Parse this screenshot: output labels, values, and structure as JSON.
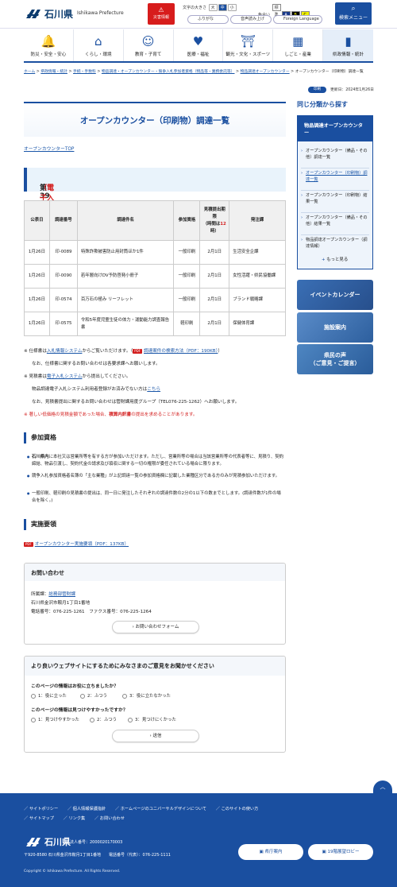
{
  "header": {
    "logo_ja": "石川県",
    "logo_en": "Ishikawa Prefecture",
    "disaster_label": "災害情報",
    "font_size_label": "文字の大きさ",
    "font_sizes": [
      "大",
      "中",
      "小"
    ],
    "color_label": "色合い",
    "colors": [
      "標準",
      "A",
      "B",
      "C"
    ],
    "furigana": "ふりがな",
    "read_aloud": "音声読み上げ",
    "foreign": "Foreign Language",
    "search_label": "検索メニュー"
  },
  "nav": [
    {
      "label": "防災・安全・安心",
      "icon": "alarm-icon"
    },
    {
      "label": "くらし・環境",
      "icon": "house-icon"
    },
    {
      "label": "教育・子育て",
      "icon": "child-icon"
    },
    {
      "label": "医療・福祉",
      "icon": "heart-hand-icon"
    },
    {
      "label": "観光・文化・スポーツ",
      "icon": "temple-icon"
    },
    {
      "label": "しごと・産業",
      "icon": "factory-icon"
    },
    {
      "label": "県政情報・統計",
      "icon": "graph-icon"
    }
  ],
  "breadcrumb": [
    "ホーム",
    "県政情報・統計",
    "手続・手数料",
    "物品調達・オープンカウンター・競争入札参加者資格（物品等・業務委託等）",
    "物品調達オープンカウンター",
    "オープンカウンター（印刷物）調達一覧"
  ],
  "print_label": "印刷",
  "updated": "更新日：2024年1月26日",
  "page_title": "オープンカウンター（印刷物）調達一覧",
  "top_link": "オープンカウンターTOP",
  "round_heading": {
    "prefix": "第39回",
    "suffix": "（電子入札）"
  },
  "table": {
    "headers": [
      "公表日",
      "調達番号",
      "調達件名",
      "参加資格",
      "見積提出期限",
      "（時間は",
      "12",
      "時）",
      "発注課"
    ],
    "rows": [
      {
        "date": "1月26日",
        "no": "印-0089",
        "name": "特殊詐欺被害防止用封筒ほか1件",
        "qual": "一般印刷",
        "due": "2月1日",
        "dept": "生活安全企課"
      },
      {
        "date": "1月26日",
        "no": "印-0090",
        "name": "若年層向けDV予防啓発小冊子",
        "qual": "一般印刷",
        "due": "2月1日",
        "dept": "女性活躍・県民協働課"
      },
      {
        "date": "1月26日",
        "no": "印-0574",
        "name": "百万石の極み リーフレット",
        "qual": "一般印刷",
        "due": "2月1日",
        "dept": "ブランド戦略課"
      },
      {
        "date": "1月26日",
        "no": "印-0575",
        "name": "令和5年度児童生徒の体力・運動能力調査報告書",
        "qual": "軽印刷",
        "due": "2月1日",
        "dept": "保健体育課"
      }
    ]
  },
  "notes": {
    "n1a": "※ 仕様書は",
    "n1_link": "入札情報システム",
    "n1b": "からご覧いただけます。（",
    "n1_pdf": "調達案件の検索方法（PDF：190KB）",
    "n1c": "）",
    "n2": "なお、仕様書に関するお問い合わせは各要求課へお願いします。",
    "n3a": "※ 見積書は",
    "n3_link": "電子入札システム",
    "n3b": "から提出してください。",
    "n4a": "物品調達電子入札システム利用者登録がお済みでない方は",
    "n4_link": "こちら",
    "n5": "なお、見積書提出に関するお問い合わせは管財課用度グループ（TEL076-225-1262）へお願いします。",
    "n6a": "※ 著しい低価格の見積金額であった場合、",
    "n6b": "積算内訳書",
    "n6c": "の提出を求めることがあります。"
  },
  "section_qual": "参加資格",
  "qual_bullets": [
    {
      "bold": "石川県内",
      "text": "に本社又は営業所等を有する方が参加いただけます。ただし、営業所等の場合は当該営業所等の代表者等に、見積り、契約締結、物品引渡し、契約代金の請求及び領収に関する一切の権限が委任されている場合に限ります。"
    },
    {
      "bold": "",
      "text": "競争入札参加資格者名簿の「主な業種」が上記調達一覧の参加資格欄に記載した業種区分である方のみが見積参加いただけます。"
    },
    {
      "bold": "",
      "text": "一般印刷、軽印刷の見積書の提出は、同一日に発注したそれぞれの調達件数の2分の1以下の数までとします。(調達件数が1件の場合を除く。)"
    }
  ],
  "section_impl": "実施要領",
  "impl_link": "オープンカウンター実施要領（PDF：137KB）",
  "contact": {
    "title": "お問い合わせ",
    "dept_label": "所属課：",
    "dept": "総務部管財課",
    "addr": "石川県金沢市鞍月1丁目1番地",
    "tel": "電話番号：076-225-1261　ファクス番号：076-225-1264",
    "form_btn": "お問い合わせフォーム"
  },
  "survey": {
    "title": "より良いウェブサイトにするためにみなさまのご意見をお聞かせください",
    "q1": "このページの情報はお役に立ちましたか？",
    "q1_opts": [
      "1：役に立った",
      "2：ふつう",
      "3：役に立たなかった"
    ],
    "q2": "このページの情報は見つけやすかったですか？",
    "q2_opts": [
      "1：見つけやすかった",
      "2：ふつう",
      "3：見つけにくかった"
    ],
    "submit": "送信"
  },
  "sidebar": {
    "heading": "同じ分類から探す",
    "top": "物品調達オープンカウンター",
    "items": [
      "オープンカウンター（備品・その他）調達一覧",
      "オープンカウンター（印刷物）調達一覧",
      "オープンカウンター（印刷物）結果一覧",
      "オープンカウンター（備品・その他）結果一覧",
      "物品調達オープンカウンター（調達情報）"
    ],
    "more": "もっと見る",
    "banners": [
      "イベントカレンダー",
      "施設案内",
      "県民の声",
      "（ご意見・ご提言）"
    ]
  },
  "footer": {
    "links1": [
      "サイトポリシー",
      "個人情報保護指針",
      "ホームページのユニバーサルデザインについて",
      "このサイトの使い方"
    ],
    "links2": [
      "サイトマップ",
      "リンク集",
      "お問い合わせ"
    ],
    "logo": "石川県",
    "corp_no": "法人番号：2000020170003",
    "address": "〒920-8580 石川県金沢市鞍月1丁目1番地　　電話番号（代表）：076-225-1111",
    "copyright": "Copyright © Ishikawa Prefecture. All Rights Reserved.",
    "btn1": "県庁案内",
    "btn2": "19階展望ロビー"
  },
  "colors": {
    "brand": "#1a4fa0",
    "alert": "#d31e1e"
  }
}
